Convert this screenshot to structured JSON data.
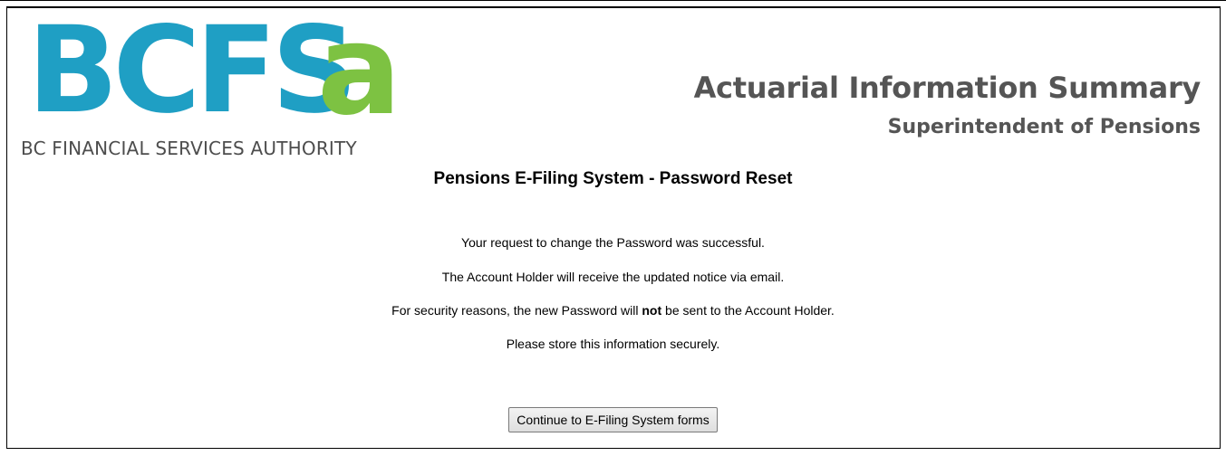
{
  "header": {
    "logo": {
      "letters": "BCFSA",
      "wordmark_main": "BCFS",
      "wordmark_accent": "a",
      "full_name": "BC FINANCIAL SERVICES AUTHORITY",
      "colors": {
        "primary": "#1f9fc4",
        "accent": "#7dc242"
      }
    },
    "title": "Actuarial Information Summary",
    "subtitle": "Superintendent of Pensions",
    "title_color": "#555555"
  },
  "page": {
    "heading": "Pensions E-Filing System - Password Reset",
    "messages": {
      "line1": "Your request to change the Password was successful.",
      "line2": "The Account Holder will receive the updated notice via email.",
      "line3_before": "For security reasons, the new Password will ",
      "line3_bold": "not",
      "line3_after": " be sent to the Account Holder.",
      "line4": "Please store this information securely."
    },
    "continue_button_label": "Continue to E-Filing System forms"
  }
}
